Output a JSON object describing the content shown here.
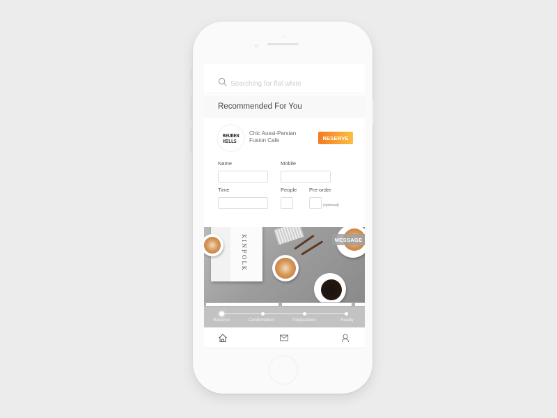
{
  "search": {
    "placeholder": "Searching for flat white",
    "icon": "search-icon"
  },
  "recommended": {
    "title": "Recommended For You"
  },
  "cafe": {
    "logo_line1": "REUBEN",
    "logo_line2": "HILLS",
    "description": "Chic Aussi-Persian Fusion Cafe",
    "reserve_label": "RESERVE",
    "reserve_colors": [
      "#f57a22",
      "#fbbe3f"
    ]
  },
  "form": {
    "name_label": "Name",
    "name_value": "",
    "mobile_label": "Mobile",
    "mobile_value": "",
    "time_label": "Time",
    "time_value": "",
    "people_label": "People",
    "people_value": "",
    "preorder_label": "Pre-order",
    "preorder_value": "",
    "optional_note": "(optional)"
  },
  "photo": {
    "magazine_title": "KINFOLK",
    "message_label": "MESSAGE"
  },
  "progress": {
    "steps": [
      {
        "label": "Reserve",
        "active": true
      },
      {
        "label": "Confirmation",
        "active": false
      },
      {
        "label": "Preparation",
        "active": false
      },
      {
        "label": "Ready",
        "active": false
      }
    ]
  },
  "tabbar": {
    "items": [
      {
        "name": "home",
        "icon": "home-icon"
      },
      {
        "name": "messages",
        "icon": "mail-icon"
      },
      {
        "name": "profile",
        "icon": "user-icon"
      }
    ]
  }
}
